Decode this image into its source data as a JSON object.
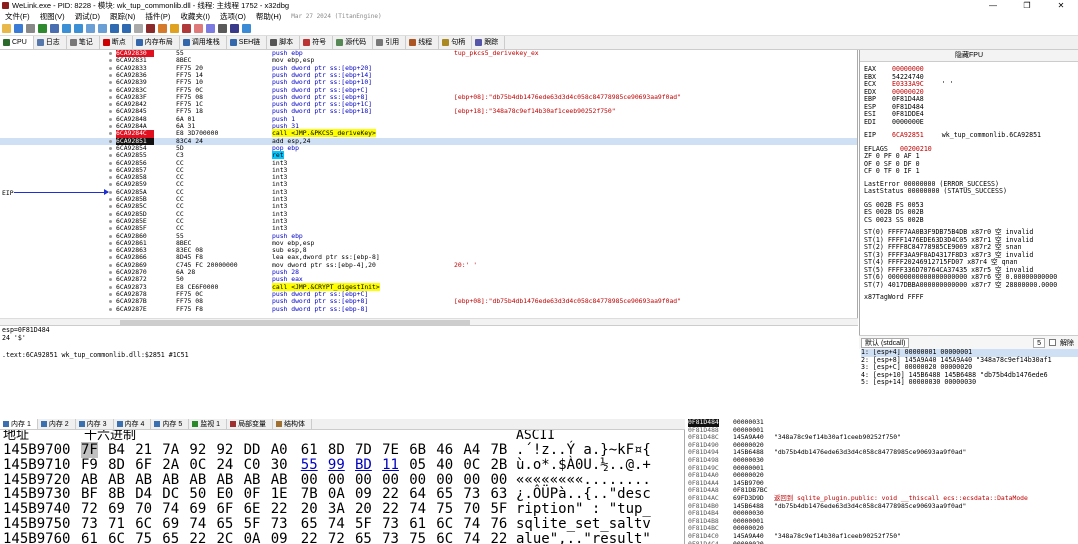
{
  "titlebar": {
    "title": "WeLink.exe - PID: 8228 - 模块: wk_tup_commonlib.dll - 线程: 主线程 1752 - x32dbg",
    "minimize": "—",
    "maximize": "❐",
    "close": "✕"
  },
  "menu": {
    "items": [
      "文件(F)",
      "视图(V)",
      "调试(D)",
      "跟踪(N)",
      "插件(P)",
      "收藏夹(I)",
      "选项(O)",
      "帮助(H)"
    ],
    "date_version": "Mar 27 2024 (TitanEngine)"
  },
  "tabs": [
    {
      "label": "CPU",
      "icon": "cpu-icon",
      "color": "#2a6a2a"
    },
    {
      "label": "日志",
      "icon": "log-icon",
      "color": "#5577aa"
    },
    {
      "label": "笔记",
      "icon": "notes-icon",
      "color": "#777777"
    },
    {
      "label": "断点",
      "icon": "breakpoint-icon",
      "color": "#cc0000"
    },
    {
      "label": "内存布局",
      "icon": "memory-map-icon",
      "color": "#3366aa"
    },
    {
      "label": "调用堆栈",
      "icon": "callstack-icon",
      "color": "#3366aa"
    },
    {
      "label": "SEH链",
      "icon": "seh-icon",
      "color": "#3366aa"
    },
    {
      "label": "脚本",
      "icon": "script-icon",
      "color": "#555555"
    },
    {
      "label": "符号",
      "icon": "symbols-icon",
      "color": "#bb3333"
    },
    {
      "label": "源代码",
      "icon": "source-icon",
      "color": "#558855"
    },
    {
      "label": "引用",
      "icon": "references-icon",
      "color": "#777777"
    },
    {
      "label": "线程",
      "icon": "threads-icon",
      "color": "#aa5522"
    },
    {
      "label": "句柄",
      "icon": "handles-icon",
      "color": "#aa8822"
    },
    {
      "label": "跟踪",
      "icon": "trace-icon",
      "color": "#5555aa"
    }
  ],
  "disasm": {
    "eip_label": "EIP",
    "rows": [
      {
        "addr": "6CA92830",
        "bytes": "55",
        "instr": "push ebp",
        "cls": "push",
        "cmt": "tup_pkcs5_derivekey_ex",
        "bp": true
      },
      {
        "addr": "6CA92831",
        "bytes": "8BEC",
        "instr": "mov ebp,esp",
        "cls": "",
        "cmt": ""
      },
      {
        "addr": "6CA92833",
        "bytes": "FF75 20",
        "instr": "push dword ptr ss:[ebp+20]",
        "cls": "push",
        "cmt": ""
      },
      {
        "addr": "6CA92836",
        "bytes": "FF75 14",
        "instr": "push dword ptr ss:[ebp+14]",
        "cls": "push",
        "cmt": ""
      },
      {
        "addr": "6CA92839",
        "bytes": "FF75 10",
        "instr": "push dword ptr ss:[ebp+10]",
        "cls": "push",
        "cmt": ""
      },
      {
        "addr": "6CA9283C",
        "bytes": "FF75 0C",
        "instr": "push dword ptr ss:[ebp+C]",
        "cls": "push",
        "cmt": ""
      },
      {
        "addr": "6CA9283F",
        "bytes": "FF75 08",
        "instr": "push dword ptr ss:[ebp+8]",
        "cls": "push",
        "cmt": "[ebp+08]:\"db75b4db1476ede63d3d4c058c84778985ce90693aa9f0ad\""
      },
      {
        "addr": "6CA92842",
        "bytes": "FF75 1C",
        "instr": "push dword ptr ss:[ebp+1C]",
        "cls": "push",
        "cmt": ""
      },
      {
        "addr": "6CA92845",
        "bytes": "FF75 18",
        "instr": "push dword ptr ss:[ebp+18]",
        "cls": "push",
        "cmt": "[ebp+18]:\"348a78c9ef14b30af1ceeb90252f750\""
      },
      {
        "addr": "6CA92848",
        "bytes": "6A 01",
        "instr": "push 1",
        "cls": "push",
        "cmt": ""
      },
      {
        "addr": "6CA9284A",
        "bytes": "6A 31",
        "instr": "push 31",
        "cls": "push",
        "cmt": ""
      },
      {
        "addr": "6CA9284C",
        "bytes": "E8 3D700000",
        "instr": "call <JMP.&PKCS5_deriveKey>",
        "cls": "call",
        "cmt": "",
        "bp": true
      },
      {
        "addr": "6CA92851",
        "bytes": "83C4 24",
        "instr": "add esp,24",
        "cls": "",
        "cmt": "",
        "eip": true
      },
      {
        "addr": "6CA92854",
        "bytes": "5D",
        "instr": "pop ebp",
        "cls": "push",
        "cmt": ""
      },
      {
        "addr": "6CA92855",
        "bytes": "C3",
        "instr": "ret",
        "cls": "ret",
        "cmt": ""
      },
      {
        "addr": "6CA92856",
        "bytes": "CC",
        "instr": "int3",
        "cls": "int",
        "cmt": ""
      },
      {
        "addr": "6CA92857",
        "bytes": "CC",
        "instr": "int3",
        "cls": "int",
        "cmt": ""
      },
      {
        "addr": "6CA92858",
        "bytes": "CC",
        "instr": "int3",
        "cls": "int",
        "cmt": ""
      },
      {
        "addr": "6CA92859",
        "bytes": "CC",
        "instr": "int3",
        "cls": "int",
        "cmt": ""
      },
      {
        "addr": "6CA9285A",
        "bytes": "CC",
        "instr": "int3",
        "cls": "int",
        "cmt": ""
      },
      {
        "addr": "6CA9285B",
        "bytes": "CC",
        "instr": "int3",
        "cls": "int",
        "cmt": ""
      },
      {
        "addr": "6CA9285C",
        "bytes": "CC",
        "instr": "int3",
        "cls": "int",
        "cmt": ""
      },
      {
        "addr": "6CA9285D",
        "bytes": "CC",
        "instr": "int3",
        "cls": "int",
        "cmt": ""
      },
      {
        "addr": "6CA9285E",
        "bytes": "CC",
        "instr": "int3",
        "cls": "int",
        "cmt": ""
      },
      {
        "addr": "6CA9285F",
        "bytes": "CC",
        "instr": "int3",
        "cls": "int",
        "cmt": ""
      },
      {
        "addr": "6CA92860",
        "bytes": "55",
        "instr": "push ebp",
        "cls": "push",
        "cmt": ""
      },
      {
        "addr": "6CA92861",
        "bytes": "8BEC",
        "instr": "mov ebp,esp",
        "cls": "",
        "cmt": ""
      },
      {
        "addr": "6CA92863",
        "bytes": "83EC 08",
        "instr": "sub esp,8",
        "cls": "",
        "cmt": ""
      },
      {
        "addr": "6CA92866",
        "bytes": "8D45 F8",
        "instr": "lea eax,dword ptr ss:[ebp-8]",
        "cls": "",
        "cmt": ""
      },
      {
        "addr": "6CA92869",
        "bytes": "C745 FC 20000000",
        "instr": "mov dword ptr ss:[ebp-4],20",
        "cls": "",
        "cmt": "20:' '"
      },
      {
        "addr": "6CA92870",
        "bytes": "6A 28",
        "instr": "push 28",
        "cls": "push",
        "cmt": ""
      },
      {
        "addr": "6CA92872",
        "bytes": "50",
        "instr": "push eax",
        "cls": "push",
        "cmt": ""
      },
      {
        "addr": "6CA92873",
        "bytes": "E8 CE6F0000",
        "instr": "call <JMP.&CRYPT_digestInit>",
        "cls": "call",
        "cmt": ""
      },
      {
        "addr": "6CA92878",
        "bytes": "FF75 0C",
        "instr": "push dword ptr ss:[ebp+C]",
        "cls": "push",
        "cmt": ""
      },
      {
        "addr": "6CA9287B",
        "bytes": "FF75 08",
        "instr": "push dword ptr ss:[ebp+8]",
        "cls": "push",
        "cmt": "[ebp+08]:\"db75b4db1476ede63d3d4c058c84778985ce90693aa9f0ad\""
      },
      {
        "addr": "6CA9287E",
        "bytes": "FF75 F8",
        "instr": "push dword ptr ss:[ebp-8]",
        "cls": "push",
        "cmt": ""
      }
    ]
  },
  "info": {
    "line1": "esp=0F81D484",
    "line2": "24 '$'",
    "line3": ".text:6CA92851 wk_tup_commonlib.dll:$2851 #1C51"
  },
  "registers": {
    "header": "隐藏FPU",
    "gp": [
      {
        "name": "EAX",
        "value": "00000000",
        "red": true
      },
      {
        "name": "EBX",
        "value": "54224740",
        "red": false
      },
      {
        "name": "ECX",
        "value": "E0333A9C",
        "red": true,
        "extra": "' '"
      },
      {
        "name": "EDX",
        "value": "00000020",
        "red": true
      },
      {
        "name": "EBP",
        "value": "0F81D4A8",
        "red": false
      },
      {
        "name": "ESP",
        "value": "0F81D484",
        "red": false
      },
      {
        "name": "ESI",
        "value": "0F81DDE4",
        "red": false
      },
      {
        "name": "EDI",
        "value": "0000000E",
        "red": false
      }
    ],
    "eip": {
      "name": "EIP",
      "value": "6CA92851",
      "extra": "wk_tup_commonlib.6CA92851"
    },
    "eflags": {
      "name": "EFLAGS",
      "value": "00200210"
    },
    "flags": [
      "ZF 0  PF 0  AF 1",
      "OF 0  SF 0  DF 0",
      "CF 0  TF 0  IF 1"
    ],
    "lasterror": "LastError  00000000 (ERROR_SUCCESS)",
    "laststatus": "LastStatus 00000000 (STATUS_SUCCESS)",
    "segs": [
      "GS 002B  FS 0053",
      "ES 002B  DS 002B",
      "CS 0023  SS 002B"
    ],
    "st": [
      "ST(0) FFFF7AA0B3F9DB75B4DB x87r0 空 invalid",
      "ST(1) FFFF1476EDE63D3D4C05 x87r1 空 invalid",
      "ST(2) FFFF8C84778985CE9069 x87r2 空 snan",
      "ST(3) FFFF3AA9F0AD4317F8D3 x87r3 空 invalid",
      "ST(4) FFFF20246912715FD07 x87r4 空 qnan",
      "ST(5) FFFF336D70764CA37435 x87r5 空 invalid",
      "ST(6) 00000000000000000000 x87r6 空 0.00000000000",
      "ST(7) 4017DBBA000000000000 x87r7 空 28800000.0000"
    ],
    "x87tag": "x87TagWord FFFF"
  },
  "callconv": {
    "label": "默认 (stdcall)",
    "count": "5",
    "unlock": "解除"
  },
  "stackargs": [
    "1: [esp+4] 00000001 00000001",
    "2: [esp+8] 145A9A40 145A9A40 \"348a78c9ef14b30af1",
    "3: [esp+C] 00000020 00000020",
    "4: [esp+10] 145B6488 145B6488 \"db75b4db1476ede6",
    "5: [esp+14] 00000030 00000030"
  ],
  "bottom_tabs": [
    "内存 1",
    "内存 2",
    "内存 3",
    "内存 4",
    "内存 5",
    "监视 1",
    "局部变量",
    "结构体"
  ],
  "dump": {
    "hdr_addr": "地址",
    "hdr_hex": "十六进制",
    "hdr_ascii": "ASCII",
    "rows": [
      {
        "addr": "145B9700",
        "hex": [
          "7F",
          "B4",
          "21",
          "7A",
          "92",
          "92",
          "DD",
          "A0",
          "61",
          "8D",
          "7D",
          "7E",
          "6B",
          "46",
          "A4",
          "7B"
        ],
        "ascii": ".´!z..Ý a.}~kF¤{"
      },
      {
        "addr": "145B9710",
        "hex": [
          "F9",
          "8D",
          "6F",
          "2A",
          "0C",
          "24",
          "C0",
          "30",
          "55",
          "99",
          "BD",
          "11",
          "05",
          "40",
          "0C",
          "2B"
        ],
        "ascii": "ù.o*.$À0U.½..@.+"
      },
      {
        "addr": "145B9720",
        "hex": [
          "AB",
          "AB",
          "AB",
          "AB",
          "AB",
          "AB",
          "AB",
          "AB",
          "00",
          "00",
          "00",
          "00",
          "00",
          "00",
          "00",
          "00"
        ],
        "ascii": "««««««««........"
      },
      {
        "addr": "145B9730",
        "hex": [
          "BF",
          "8B",
          "D4",
          "DC",
          "50",
          "E0",
          "0F",
          "1E",
          "7B",
          "0A",
          "09",
          "22",
          "64",
          "65",
          "73",
          "63"
        ],
        "ascii": "¿.ÔÜPà..{..\"desc"
      },
      {
        "addr": "145B9740",
        "hex": [
          "72",
          "69",
          "70",
          "74",
          "69",
          "6F",
          "6E",
          "22",
          "20",
          "3A",
          "20",
          "22",
          "74",
          "75",
          "70",
          "5F"
        ],
        "ascii": "ription\" : \"tup_"
      },
      {
        "addr": "145B9750",
        "hex": [
          "73",
          "71",
          "6C",
          "69",
          "74",
          "65",
          "5F",
          "73",
          "65",
          "74",
          "5F",
          "73",
          "61",
          "6C",
          "74",
          "76"
        ],
        "ascii": "sqlite_set_saltv"
      },
      {
        "addr": "145B9760",
        "hex": [
          "61",
          "6C",
          "75",
          "65",
          "22",
          "2C",
          "0A",
          "09",
          "22",
          "72",
          "65",
          "73",
          "75",
          "6C",
          "74",
          "22"
        ],
        "ascii": "alue\",..\"result\""
      }
    ]
  },
  "stackdump": [
    {
      "addr": "0F81D484",
      "val": "00000031",
      "cmt": "",
      "cur": true
    },
    {
      "addr": "0F81D488",
      "val": "00000001",
      "cmt": ""
    },
    {
      "addr": "0F81D48C",
      "val": "145A9A40",
      "cmt": "\"348a78c9ef14b30af1ceeb90252f750\""
    },
    {
      "addr": "0F81D490",
      "val": "00000020",
      "cmt": ""
    },
    {
      "addr": "0F81D494",
      "val": "145B6488",
      "cmt": "\"db75b4db1476ede63d3d4c058c84778985ce90693aa9f0ad\""
    },
    {
      "addr": "0F81D498",
      "val": "00000030",
      "cmt": ""
    },
    {
      "addr": "0F81D49C",
      "val": "00000001",
      "cmt": ""
    },
    {
      "addr": "0F81D4A0",
      "val": "00000020",
      "cmt": ""
    },
    {
      "addr": "0F81D4A4",
      "val": "145B9700",
      "cmt": ""
    },
    {
      "addr": "0F81D4A8",
      "val": "0F81DB7BC",
      "cmt": ""
    },
    {
      "addr": "0F81D4AC",
      "val": "69FD3D9D",
      "cmt": "返回到 sqlite_plugin.public: void __thiscall ecs::ecsdata::DataMode",
      "red": true
    },
    {
      "addr": "0F81D4B0",
      "val": "145B6488",
      "cmt": "\"db75b4db1476ede63d3d4c058c84778985ce90693aa9f0ad\""
    },
    {
      "addr": "0F81D4B4",
      "val": "00000030",
      "cmt": ""
    },
    {
      "addr": "0F81D4B8",
      "val": "00000001",
      "cmt": ""
    },
    {
      "addr": "0F81D4BC",
      "val": "00000020",
      "cmt": ""
    },
    {
      "addr": "0F81D4C0",
      "val": "145A9A40",
      "cmt": "\"348a78c9ef14b30af1ceeb90252f750\""
    },
    {
      "addr": "0F81D4C4",
      "val": "00000020",
      "cmt": ""
    }
  ]
}
